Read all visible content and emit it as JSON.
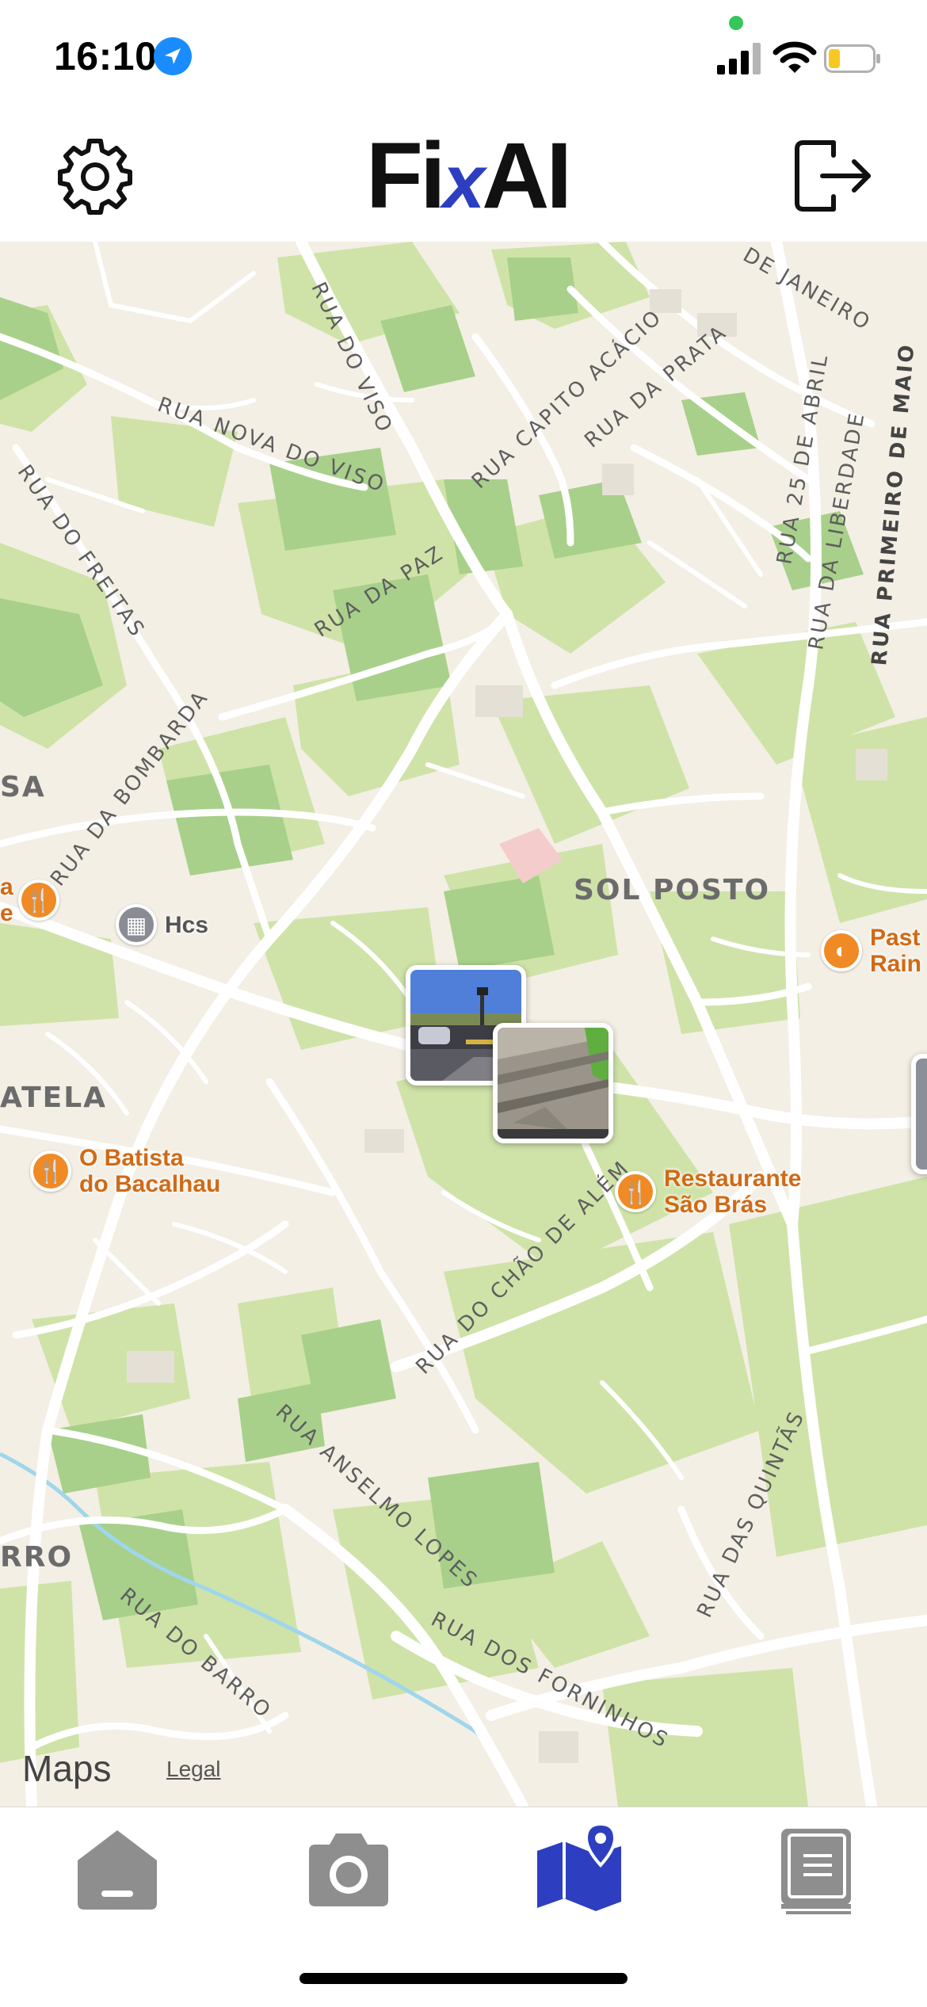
{
  "status_bar": {
    "time": "16:10"
  },
  "header": {
    "logo_part1": "Fi",
    "logo_part2": "x",
    "logo_part3": "AI",
    "settings_icon": "gear-icon",
    "logout_icon": "logout-icon"
  },
  "map": {
    "streets": [
      "RUA DO VISO",
      "RUA NOVA DO VISO",
      "RUA CAPITO ACÁCIO",
      "RUA DA PRATA",
      "DE JANEIRO",
      "RUA DO FREITAS",
      "RUA DA PAZ",
      "RUA 25 DE ABRIL",
      "RUA DA LIBERDADE",
      "RUA PRIMEIRO DE MAIO",
      "RUA DA BOMBARDA",
      "RUA DO CHÃO DE ALÉM",
      "RUA DAS QUINTÃS",
      "RUA ANSELMO LOPES",
      "RUA DOS FORNINHOS",
      "RUA DO BARRO"
    ],
    "districts": [
      "SOL POSTO",
      "SA",
      "ATELA",
      "RRO"
    ],
    "pois": [
      {
        "label_line1": "Hcs",
        "label_line2": ""
      },
      {
        "label_line1": "O Batista",
        "label_line2": "do Bacalhau"
      },
      {
        "label_line1": "Restaurante",
        "label_line2": "São Brás"
      },
      {
        "label_line1": "Past",
        "label_line2": "Rain"
      },
      {
        "label_line1": "a",
        "label_line2": "e"
      }
    ],
    "attribution": "Maps",
    "legal": "Legal"
  },
  "tabbar": {
    "items": [
      {
        "icon": "home-icon",
        "active": false
      },
      {
        "icon": "camera-icon",
        "active": false
      },
      {
        "icon": "map-icon",
        "active": true
      },
      {
        "icon": "book-icon",
        "active": false
      }
    ]
  },
  "colors": {
    "active_tab": "#2d3fc0",
    "inactive_tab": "#8e8e8e",
    "poi": "#f08a24"
  }
}
